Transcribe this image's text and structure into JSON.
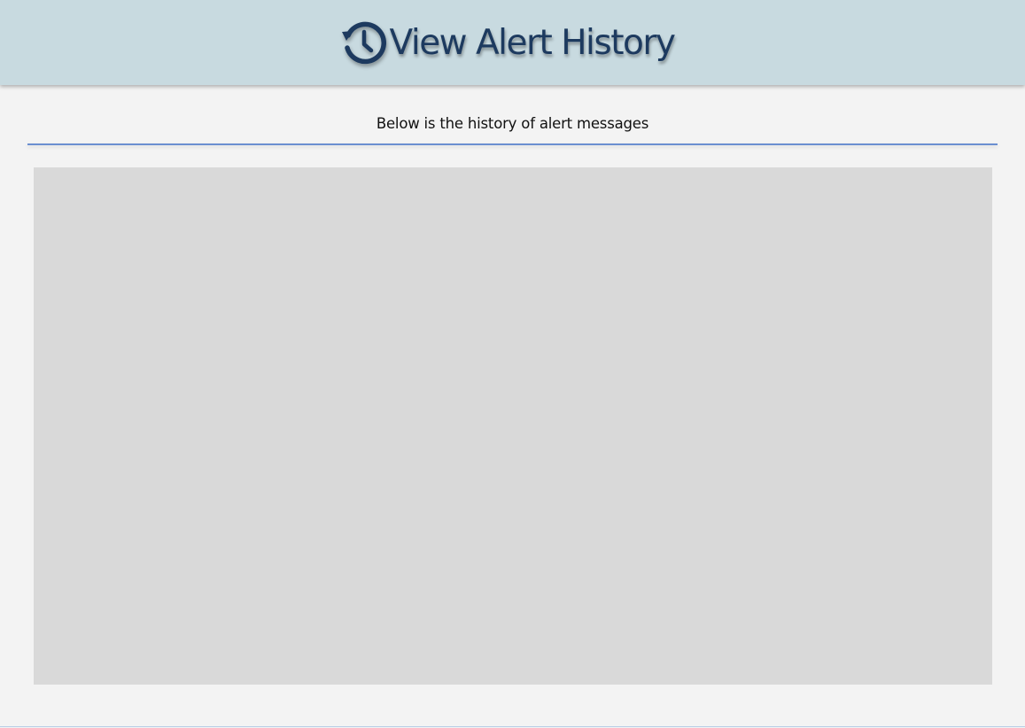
{
  "header": {
    "icon": "history-icon",
    "title": "View Alert History",
    "background_color": "#c8dae0",
    "title_color": "#1d3a5f"
  },
  "main": {
    "subtitle": "Below is the history of alert messages",
    "divider_color": "#6b8fd0",
    "history_panel_color": "#d9d9d9"
  }
}
